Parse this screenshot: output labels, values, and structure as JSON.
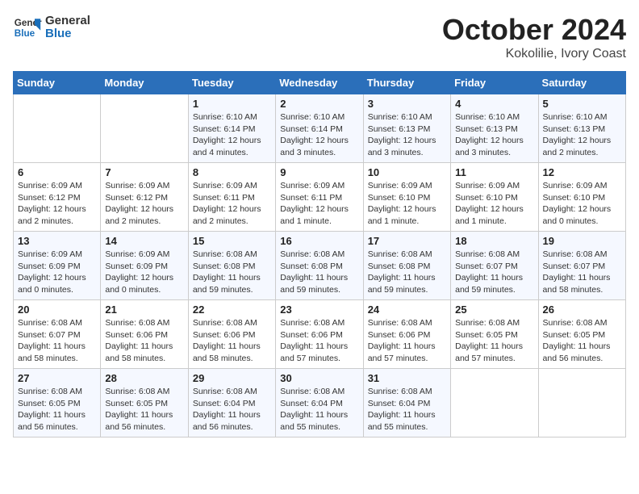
{
  "header": {
    "logo_line1": "General",
    "logo_line2": "Blue",
    "month": "October 2024",
    "location": "Kokolilie, Ivory Coast"
  },
  "days_of_week": [
    "Sunday",
    "Monday",
    "Tuesday",
    "Wednesday",
    "Thursday",
    "Friday",
    "Saturday"
  ],
  "weeks": [
    [
      {
        "day": "",
        "info": ""
      },
      {
        "day": "",
        "info": ""
      },
      {
        "day": "1",
        "info": "Sunrise: 6:10 AM\nSunset: 6:14 PM\nDaylight: 12 hours and 4 minutes."
      },
      {
        "day": "2",
        "info": "Sunrise: 6:10 AM\nSunset: 6:14 PM\nDaylight: 12 hours and 3 minutes."
      },
      {
        "day": "3",
        "info": "Sunrise: 6:10 AM\nSunset: 6:13 PM\nDaylight: 12 hours and 3 minutes."
      },
      {
        "day": "4",
        "info": "Sunrise: 6:10 AM\nSunset: 6:13 PM\nDaylight: 12 hours and 3 minutes."
      },
      {
        "day": "5",
        "info": "Sunrise: 6:10 AM\nSunset: 6:13 PM\nDaylight: 12 hours and 2 minutes."
      }
    ],
    [
      {
        "day": "6",
        "info": "Sunrise: 6:09 AM\nSunset: 6:12 PM\nDaylight: 12 hours and 2 minutes."
      },
      {
        "day": "7",
        "info": "Sunrise: 6:09 AM\nSunset: 6:12 PM\nDaylight: 12 hours and 2 minutes."
      },
      {
        "day": "8",
        "info": "Sunrise: 6:09 AM\nSunset: 6:11 PM\nDaylight: 12 hours and 2 minutes."
      },
      {
        "day": "9",
        "info": "Sunrise: 6:09 AM\nSunset: 6:11 PM\nDaylight: 12 hours and 1 minute."
      },
      {
        "day": "10",
        "info": "Sunrise: 6:09 AM\nSunset: 6:10 PM\nDaylight: 12 hours and 1 minute."
      },
      {
        "day": "11",
        "info": "Sunrise: 6:09 AM\nSunset: 6:10 PM\nDaylight: 12 hours and 1 minute."
      },
      {
        "day": "12",
        "info": "Sunrise: 6:09 AM\nSunset: 6:10 PM\nDaylight: 12 hours and 0 minutes."
      }
    ],
    [
      {
        "day": "13",
        "info": "Sunrise: 6:09 AM\nSunset: 6:09 PM\nDaylight: 12 hours and 0 minutes."
      },
      {
        "day": "14",
        "info": "Sunrise: 6:09 AM\nSunset: 6:09 PM\nDaylight: 12 hours and 0 minutes."
      },
      {
        "day": "15",
        "info": "Sunrise: 6:08 AM\nSunset: 6:08 PM\nDaylight: 11 hours and 59 minutes."
      },
      {
        "day": "16",
        "info": "Sunrise: 6:08 AM\nSunset: 6:08 PM\nDaylight: 11 hours and 59 minutes."
      },
      {
        "day": "17",
        "info": "Sunrise: 6:08 AM\nSunset: 6:08 PM\nDaylight: 11 hours and 59 minutes."
      },
      {
        "day": "18",
        "info": "Sunrise: 6:08 AM\nSunset: 6:07 PM\nDaylight: 11 hours and 59 minutes."
      },
      {
        "day": "19",
        "info": "Sunrise: 6:08 AM\nSunset: 6:07 PM\nDaylight: 11 hours and 58 minutes."
      }
    ],
    [
      {
        "day": "20",
        "info": "Sunrise: 6:08 AM\nSunset: 6:07 PM\nDaylight: 11 hours and 58 minutes."
      },
      {
        "day": "21",
        "info": "Sunrise: 6:08 AM\nSunset: 6:06 PM\nDaylight: 11 hours and 58 minutes."
      },
      {
        "day": "22",
        "info": "Sunrise: 6:08 AM\nSunset: 6:06 PM\nDaylight: 11 hours and 58 minutes."
      },
      {
        "day": "23",
        "info": "Sunrise: 6:08 AM\nSunset: 6:06 PM\nDaylight: 11 hours and 57 minutes."
      },
      {
        "day": "24",
        "info": "Sunrise: 6:08 AM\nSunset: 6:06 PM\nDaylight: 11 hours and 57 minutes."
      },
      {
        "day": "25",
        "info": "Sunrise: 6:08 AM\nSunset: 6:05 PM\nDaylight: 11 hours and 57 minutes."
      },
      {
        "day": "26",
        "info": "Sunrise: 6:08 AM\nSunset: 6:05 PM\nDaylight: 11 hours and 56 minutes."
      }
    ],
    [
      {
        "day": "27",
        "info": "Sunrise: 6:08 AM\nSunset: 6:05 PM\nDaylight: 11 hours and 56 minutes."
      },
      {
        "day": "28",
        "info": "Sunrise: 6:08 AM\nSunset: 6:05 PM\nDaylight: 11 hours and 56 minutes."
      },
      {
        "day": "29",
        "info": "Sunrise: 6:08 AM\nSunset: 6:04 PM\nDaylight: 11 hours and 56 minutes."
      },
      {
        "day": "30",
        "info": "Sunrise: 6:08 AM\nSunset: 6:04 PM\nDaylight: 11 hours and 55 minutes."
      },
      {
        "day": "31",
        "info": "Sunrise: 6:08 AM\nSunset: 6:04 PM\nDaylight: 11 hours and 55 minutes."
      },
      {
        "day": "",
        "info": ""
      },
      {
        "day": "",
        "info": ""
      }
    ]
  ]
}
